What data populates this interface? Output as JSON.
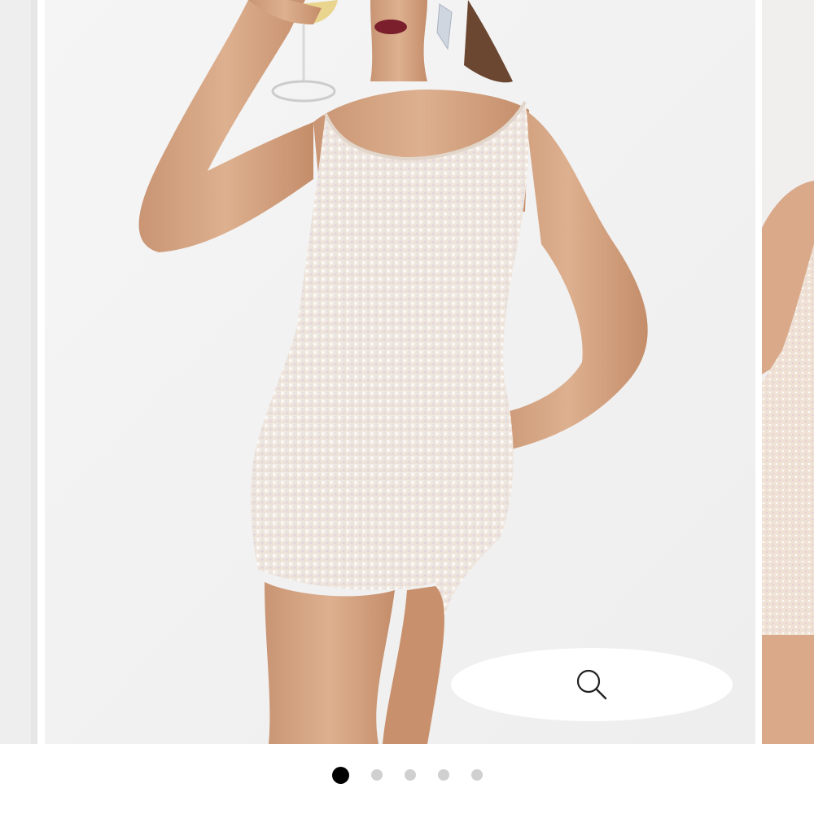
{
  "gallery": {
    "image_subject": "model-in-sequin-mini-dress",
    "zoom_icon": "magnifier-icon",
    "slide_count": 5,
    "active_slide": 1
  },
  "colors": {
    "dress": "#f2ebe4",
    "skin": "#d7a784",
    "background": "#f3f3f3",
    "dot_active": "#000000",
    "dot_inactive": "#d0d0d0"
  },
  "pagination": {
    "dots": [
      {
        "active": true
      },
      {
        "active": false
      },
      {
        "active": false
      },
      {
        "active": false
      },
      {
        "active": false
      }
    ]
  }
}
